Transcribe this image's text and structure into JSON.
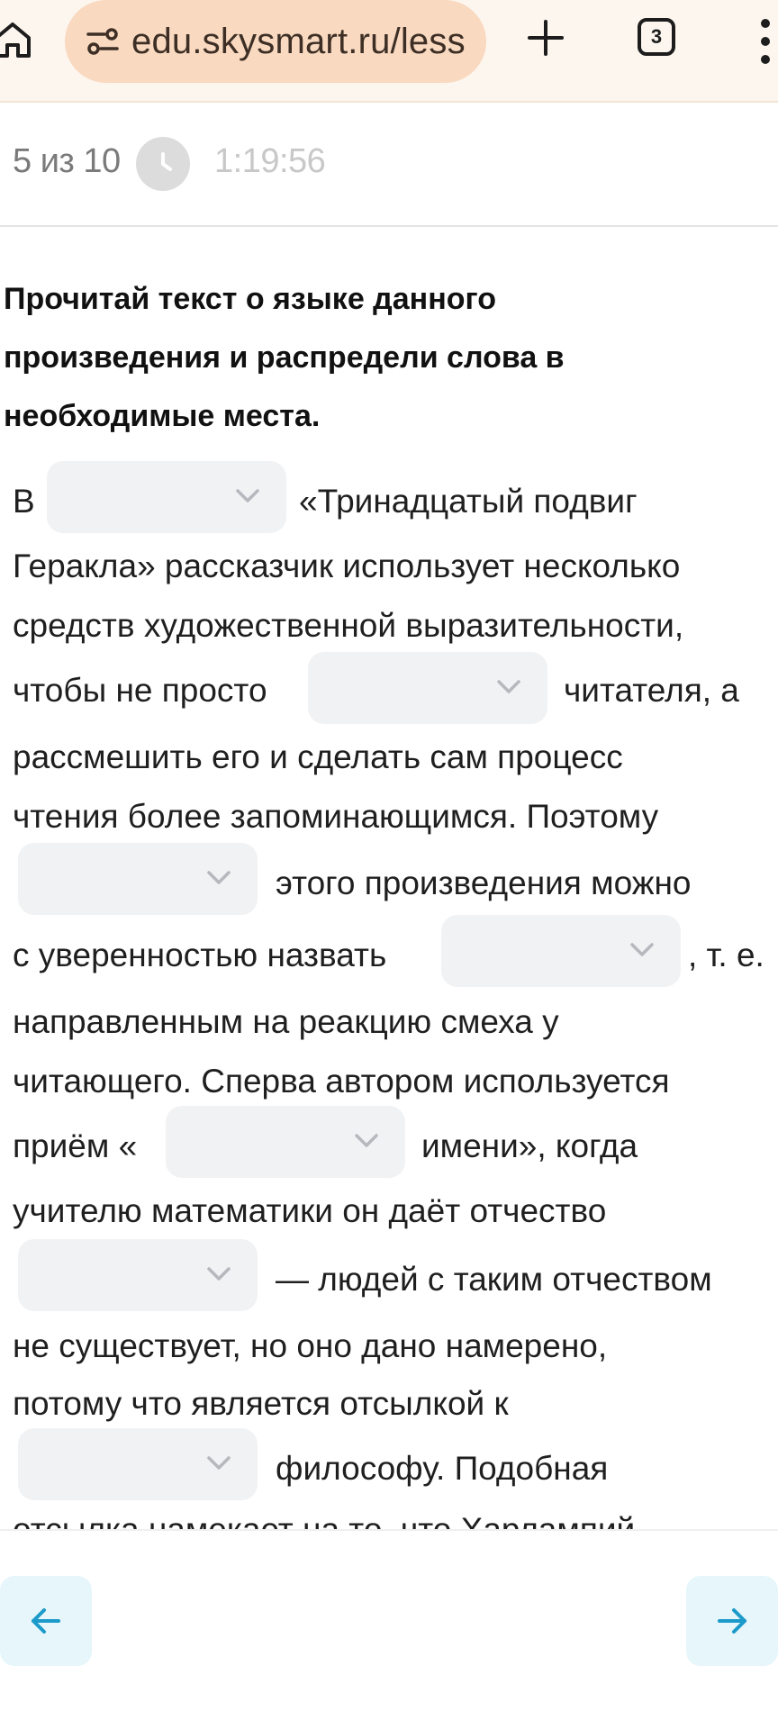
{
  "browser": {
    "url": "edu.skysmart.ru/less",
    "tab_count": "3",
    "icons": [
      "home-icon",
      "site-settings-icon",
      "plus-icon",
      "tabs-icon",
      "more-vertical-icon"
    ]
  },
  "lesson": {
    "progress": "5 из 10",
    "timer": "1:19:56"
  },
  "task": {
    "title_lines": [
      "Прочитай текст о языке данного",
      "произведения и распредели слова в",
      "необходимые места."
    ],
    "lines": [
      "В",
      "«Тринадцатый подвиг",
      "Геракла» рассказчик использует несколько",
      "средств художественной выразительности,",
      "чтобы не просто",
      "читателя, а",
      "рассмешить его и сделать сам процесс",
      "чтения более запоминающимся. Поэтому",
      "этого произведения можно",
      "с уверенностью назвать",
      ", т. е.",
      "направленным на реакцию смеха у",
      "читающего. Сперва автором используется",
      "приём «",
      "имени», когда",
      "учителю математики он даёт отчество",
      "— людей с таким отчеством",
      "не существует, но оно дано намерено,",
      "потому что является отсылкой к",
      "философу. Подобная",
      "отсылка намекает на то, что Харлампий"
    ],
    "dropdowns": [
      {
        "value": ""
      },
      {
        "value": ""
      },
      {
        "value": ""
      },
      {
        "value": ""
      },
      {
        "value": ""
      },
      {
        "value": ""
      },
      {
        "value": ""
      }
    ]
  },
  "navigation": {
    "prev_icon": "arrow-left-icon",
    "next_icon": "arrow-right-icon"
  },
  "colors": {
    "url_pill": "#f9d9c0",
    "browser_bar": "#fdf6ee",
    "dropdown_bg": "#f1f2f4",
    "nav_button_bg": "#e6f6fb",
    "nav_arrow": "#1c9ac9"
  }
}
